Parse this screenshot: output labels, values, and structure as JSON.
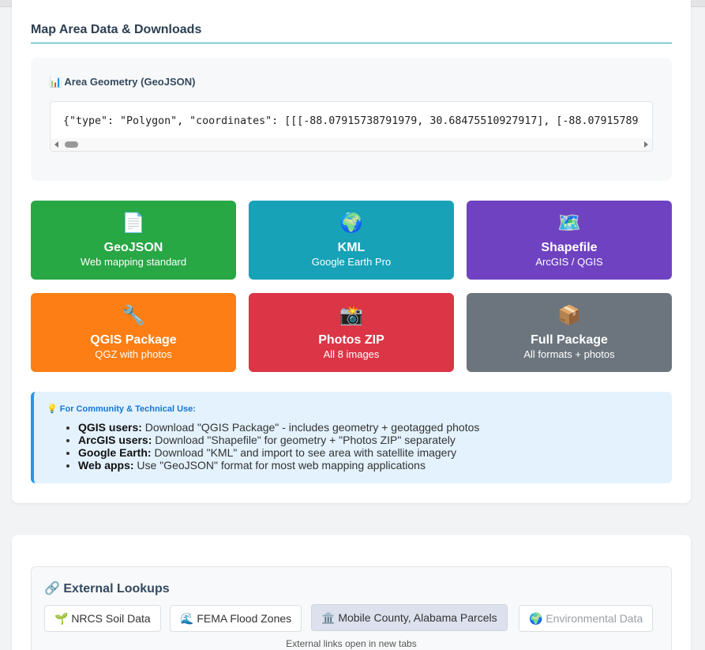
{
  "section": {
    "title": "Map Area Data & Downloads"
  },
  "geometry": {
    "icon": "bar-chart-icon",
    "label": "📊 Area Geometry (GeoJSON)",
    "code": "{\"type\": \"Polygon\", \"coordinates\": [[[-88.07915738791979, 30.68475510927917], [-88.07915789"
  },
  "downloads": [
    {
      "icon": "📄",
      "icon_name": "document-icon",
      "title": "GeoJSON",
      "subtitle": "Web mapping standard",
      "color": "#28a745"
    },
    {
      "icon": "🌍",
      "icon_name": "globe-icon",
      "title": "KML",
      "subtitle": "Google Earth Pro",
      "color": "#17a2b8"
    },
    {
      "icon": "🗺️",
      "icon_name": "map-icon",
      "title": "Shapefile",
      "subtitle": "ArcGIS / QGIS",
      "color": "#6f42c1"
    },
    {
      "icon": "🔧",
      "icon_name": "wrench-icon",
      "title": "QGIS Package",
      "subtitle": "QGZ with photos",
      "color": "#fd7e14"
    },
    {
      "icon": "📸",
      "icon_name": "camera-icon",
      "title": "Photos ZIP",
      "subtitle": "All 8 images",
      "color": "#dc3545"
    },
    {
      "icon": "📦",
      "icon_name": "package-icon",
      "title": "Full Package",
      "subtitle": "All formats + photos",
      "color": "#6c757d"
    }
  ],
  "tips": {
    "heading": "💡 For Community & Technical Use:",
    "items": [
      {
        "label": "QGIS users:",
        "text": " Download \"QGIS Package\" - includes geometry + geotagged photos"
      },
      {
        "label": "ArcGIS users:",
        "text": " Download \"Shapefile\" for geometry + \"Photos ZIP\" separately"
      },
      {
        "label": "Google Earth:",
        "text": " Download \"KML\" and import to see area with satellite imagery"
      },
      {
        "label": "Web apps:",
        "text": " Use \"GeoJSON\" format for most web mapping applications"
      }
    ]
  },
  "external": {
    "title": "🔗 External Lookups",
    "buttons": [
      {
        "label": "🌱 NRCS Soil Data",
        "state": "normal"
      },
      {
        "label": "🌊 FEMA Flood Zones",
        "state": "normal"
      },
      {
        "label": "🏛️ Mobile County, Alabama Parcels",
        "state": "active"
      },
      {
        "label": "🌍 Environmental Data",
        "state": "disabled"
      }
    ],
    "note": "External links open in new tabs"
  }
}
